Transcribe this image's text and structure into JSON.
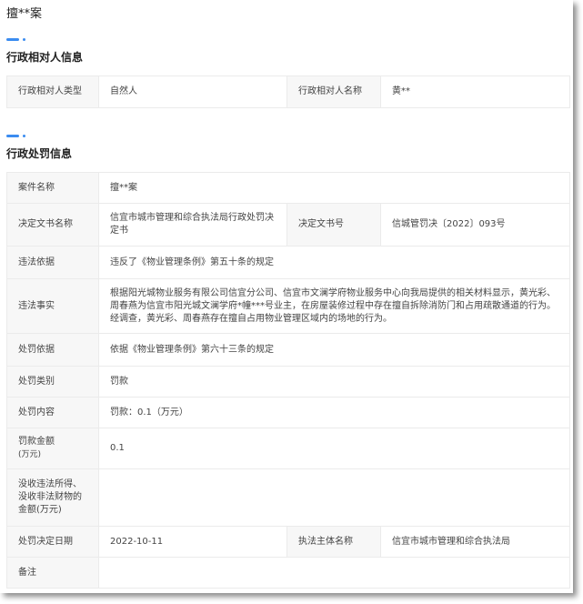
{
  "title": "擅**案",
  "party_section": {
    "heading": "行政相对人信息",
    "type_label": "行政相对人类型",
    "type_value": "自然人",
    "name_label": "行政相对人名称",
    "name_value": "黄**"
  },
  "penalty_section": {
    "heading": "行政处罚信息",
    "case_name_label": "案件名称",
    "case_name": "擅**案",
    "doc_name_label": "决定文书名称",
    "doc_name": "信宜市城市管理和综合执法局行政处罚决定书",
    "doc_no_label": "决定文书号",
    "doc_no": "信城管罚决〔2022〕093号",
    "basis_label": "违法依据",
    "basis": "违反了《物业管理条例》第五十条的规定",
    "facts_label": "违法事实",
    "facts": "根据阳光城物业服务有限公司信宜分公司、信宜市文澜学府物业服务中心向我局提供的相关材料显示，黄光彩、周春燕为信宜市阳光城文澜学府*幢***号业主，在房屋装修过程中存在擅自拆除消防门和占用疏散通道的行为。经调查，黄光彩、周春燕存在擅自占用物业管理区域内的场地的行为。",
    "penalty_basis_label": "处罚依据",
    "penalty_basis": "依据《物业管理条例》第六十三条的规定",
    "category_label": "处罚类别",
    "category": "罚款",
    "content_label": "处罚内容",
    "content": "罚款：0.1（万元）",
    "fine_label": "罚款金额",
    "fine_unit": "(万元)",
    "fine": "0.1",
    "confiscation_label": "没收违法所得、没收非法财物的金额(万元)",
    "confiscation": "",
    "date_label": "处罚决定日期",
    "date": "2022-10-11",
    "authority_label": "执法主体名称",
    "authority": "信宜市城市管理和综合执法局",
    "remarks_label": "备注",
    "remarks": ""
  }
}
